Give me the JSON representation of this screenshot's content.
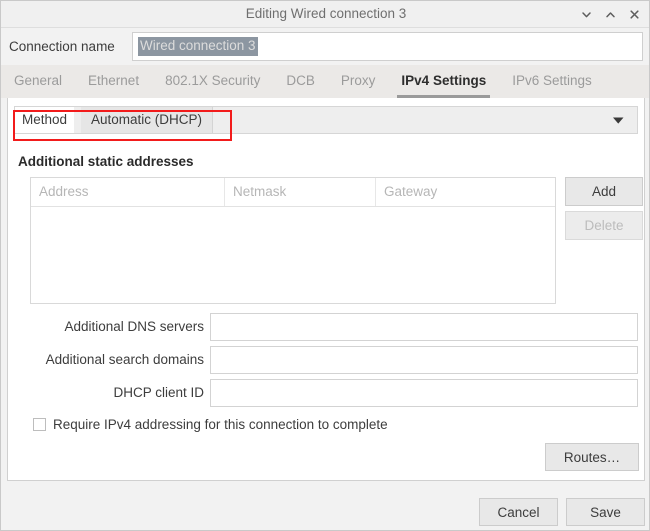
{
  "window": {
    "title": "Editing Wired connection 3",
    "controls": [
      {
        "name": "minimize",
        "glyph": "chevron-down"
      },
      {
        "name": "maximize",
        "glyph": "chevron-up"
      },
      {
        "name": "close",
        "glyph": "x"
      }
    ]
  },
  "connection": {
    "label": "Connection name",
    "value": "Wired connection 3",
    "placeholder": ""
  },
  "tabs": [
    {
      "label": "General",
      "active": false
    },
    {
      "label": "Ethernet",
      "active": false
    },
    {
      "label": "802.1X Security",
      "active": false
    },
    {
      "label": "DCB",
      "active": false
    },
    {
      "label": "Proxy",
      "active": false
    },
    {
      "label": "IPv4 Settings",
      "active": true
    },
    {
      "label": "IPv6 Settings",
      "active": false
    }
  ],
  "method": {
    "label": "Method",
    "value": "Automatic (DHCP)",
    "arrow_icon": "triangle-down-icon",
    "highlight_color": "#f21b1b"
  },
  "static_addresses": {
    "section_title": "Additional static addresses",
    "columns": [
      "Address",
      "Netmask",
      "Gateway"
    ],
    "rows": [],
    "add_label": "Add",
    "delete_label": "Delete",
    "delete_enabled": false
  },
  "fields": {
    "dns": {
      "label": "Additional DNS servers",
      "value": "",
      "placeholder": ""
    },
    "search": {
      "label": "Additional search domains",
      "value": "",
      "placeholder": ""
    },
    "dhcp_client_id": {
      "label": "DHCP client ID",
      "value": "",
      "placeholder": ""
    }
  },
  "require_ipv4": {
    "label": "Require IPv4 addressing for this connection to complete",
    "checked": false
  },
  "routes": {
    "label": "Routes…"
  },
  "footer": {
    "cancel_label": "Cancel",
    "save_label": "Save"
  }
}
